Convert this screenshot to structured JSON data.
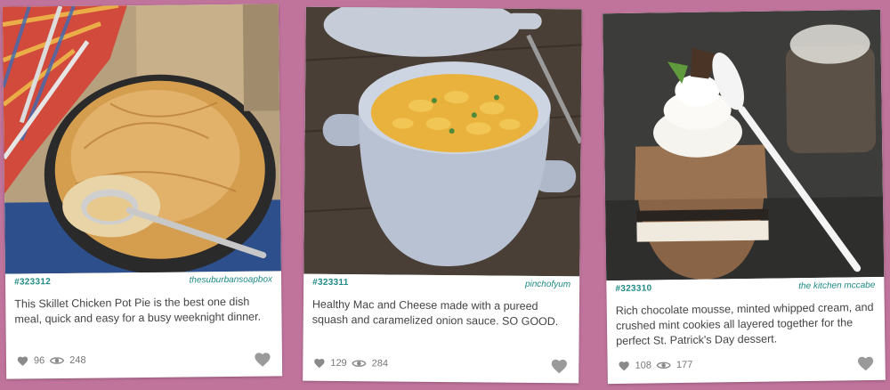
{
  "cards": [
    {
      "id": "#323312",
      "source": "thesuburbansoapbox",
      "description": "This Skillet Chicken Pot Pie is the best one dish meal, quick and easy for a busy weeknight dinner.",
      "likes": "96",
      "views": "248"
    },
    {
      "id": "#323311",
      "source": "pinchofyum",
      "description": "Healthy Mac and Cheese made with a pureed squash and caramelized onion sauce. SO GOOD.",
      "likes": "129",
      "views": "284"
    },
    {
      "id": "#323310",
      "source": "the kitchen mccabe",
      "description": "Rich chocolate mousse, minted whipped cream, and crushed mint cookies all layered together for the perfect St. Patrick's Day dessert.",
      "likes": "108",
      "views": "177"
    }
  ],
  "colors": {
    "background": "#c0749c",
    "accent": "#1e8a86",
    "icon": "#8a8a8a"
  },
  "icons": {
    "like": "heart-icon",
    "views": "eye-icon",
    "save": "heart-outline-icon"
  }
}
